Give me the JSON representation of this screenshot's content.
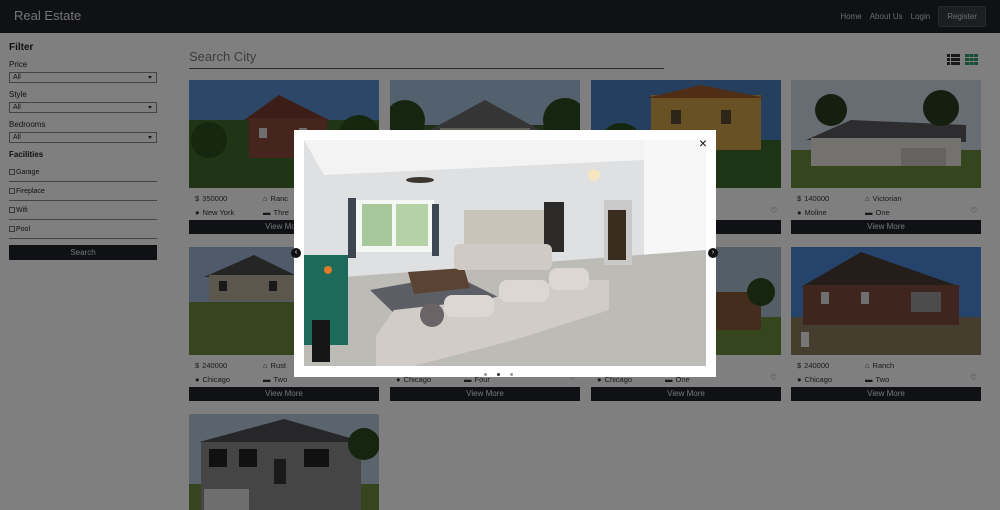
{
  "navbar": {
    "brand": "Real Estate",
    "links": [
      "Home",
      "About Us",
      "Login"
    ],
    "register": "Register"
  },
  "sidebar": {
    "title": "Filter",
    "filters": [
      {
        "label": "Price",
        "value": "All"
      },
      {
        "label": "Style",
        "value": "All"
      },
      {
        "label": "Bedrooms",
        "value": "All"
      }
    ],
    "facilities_title": "Facilities",
    "facilities": [
      "Garage",
      "Fireplace",
      "Wifi",
      "Pool"
    ],
    "search_button": "Search"
  },
  "main": {
    "search_placeholder": "Search City",
    "view_more": "View More",
    "listings": [
      {
        "price": "350000",
        "style": "Ranc",
        "city": "New York",
        "bedrooms": "Thre"
      },
      {
        "price": "",
        "style": "",
        "city": "",
        "bedrooms": ""
      },
      {
        "price": "",
        "style": "",
        "city": "",
        "bedrooms": ""
      },
      {
        "price": "140000",
        "style": "Victorian",
        "city": "Moline",
        "bedrooms": "One"
      },
      {
        "price": "240000",
        "style": "Rust",
        "city": "Chicago",
        "bedrooms": "Two"
      },
      {
        "price": "",
        "style": "",
        "city": "Chicago",
        "bedrooms": "Four"
      },
      {
        "price": "",
        "style": "",
        "city": "Chicago",
        "bedrooms": "One"
      },
      {
        "price": "240000",
        "style": "Ranch",
        "city": "Chicago",
        "bedrooms": "Two"
      },
      {
        "price": "",
        "style": "",
        "city": "",
        "bedrooms": ""
      }
    ]
  },
  "modal": {
    "close_label": "×",
    "slide_count": 3,
    "active_slide": 2
  },
  "colors": {
    "navbar": "#1f2228",
    "grid_icon_active": "#2e9a6b"
  }
}
